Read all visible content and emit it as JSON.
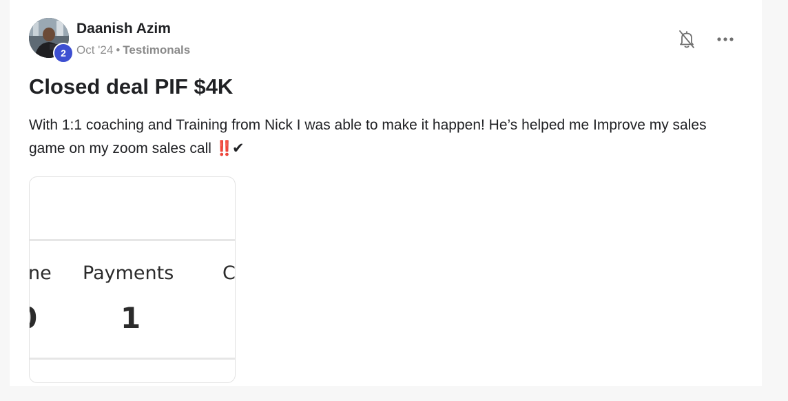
{
  "post": {
    "author": {
      "name": "Daanish Azim",
      "level": "2"
    },
    "meta": {
      "date": "Oct '24",
      "separator": "•",
      "category": "Testimonals"
    },
    "title": "Closed deal PIF $4K",
    "body_text": "With 1:1 coaching and Training from Nick I was able to make it happen! He’s helped me Improve my sales game on my zoom sales call ",
    "body_emoji_bang": "‼️",
    "body_emoji_check": "✔",
    "attachment": {
      "left_fragment": "ne",
      "left_value_fragment": "0",
      "center_label": "Payments",
      "center_value": "1",
      "right_fragment": "C"
    }
  },
  "icons": {
    "notification": "bell-off-icon",
    "more": "more-horizontal-icon"
  },
  "colors": {
    "badge": "#3d4fd1",
    "emoji_red": "#e0241b",
    "meta_gray": "#909090"
  }
}
